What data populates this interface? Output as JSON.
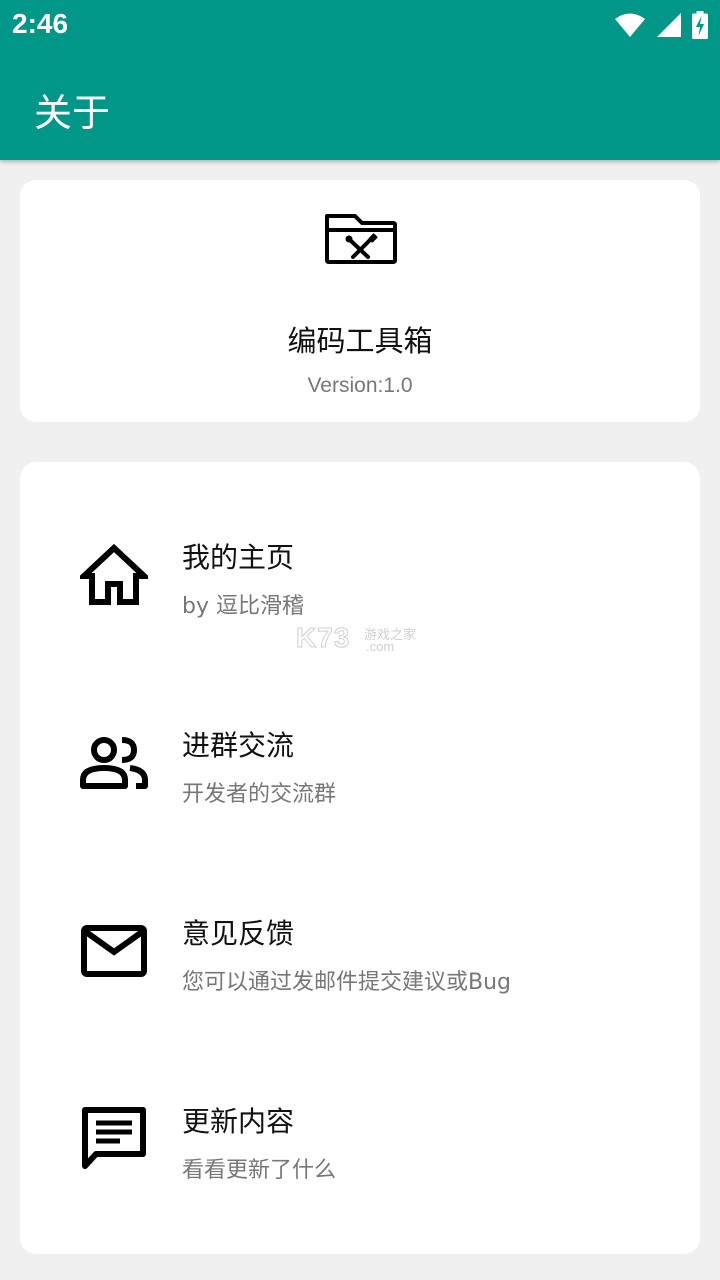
{
  "status_bar": {
    "time": "2:46",
    "icons": [
      "wifi-icon",
      "cell-signal-icon",
      "battery-charging-icon"
    ]
  },
  "toolbar": {
    "title": "关于"
  },
  "about": {
    "logo_icon": "toolbox-folder-icon",
    "app_name": "编码工具箱",
    "version": "Version:1.0"
  },
  "menu": {
    "items": [
      {
        "icon": "home-icon",
        "title": "我的主页",
        "subtitle": "by 逗比滑稽"
      },
      {
        "icon": "group-icon",
        "title": "进群交流",
        "subtitle": "开发者的交流群"
      },
      {
        "icon": "mail-icon",
        "title": "意见反馈",
        "subtitle": "您可以通过发邮件提交建议或Bug"
      },
      {
        "icon": "message-icon",
        "title": "更新内容",
        "subtitle": "看看更新了什么"
      }
    ]
  },
  "watermark": {
    "brand": "K73",
    "tagline": "游戏之家",
    "domain": ".com"
  },
  "colors": {
    "primary": "#009688",
    "background": "#f0f0f0",
    "card": "#ffffff",
    "title_text": "#111111",
    "secondary_text": "#777777"
  }
}
